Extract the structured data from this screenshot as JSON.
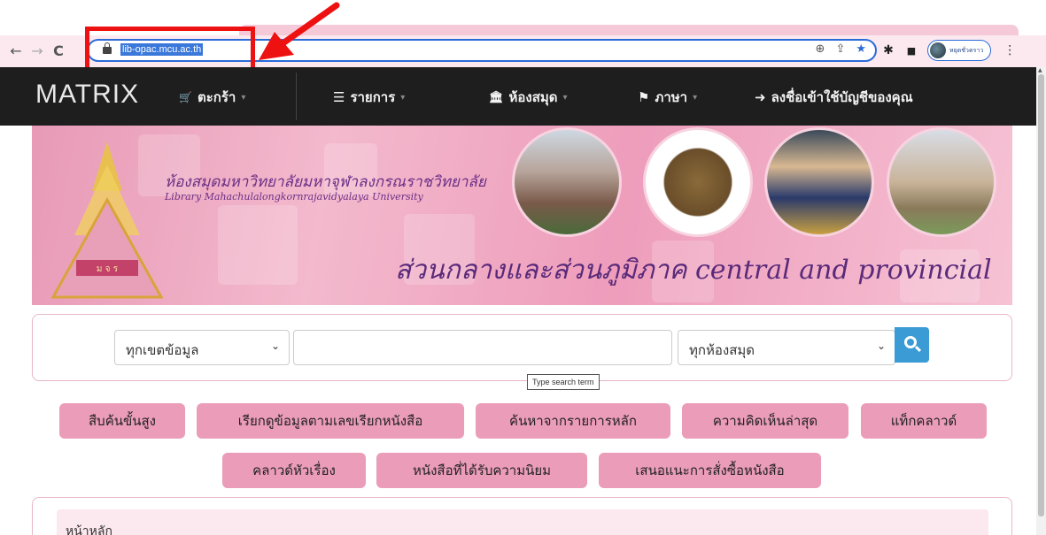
{
  "browser": {
    "url": "lib-opac.mcu.ac.th",
    "profile_name": "หยุดชั่วคราว",
    "nav": {
      "back": "←",
      "forward": "→",
      "reload": "C"
    },
    "omni_icons": {
      "zoom": "⊕",
      "share": "⇪",
      "star": "★"
    },
    "ext_icons": {
      "puzzle": "✱",
      "sidebar": "■",
      "menu": "⋮"
    }
  },
  "site_nav": {
    "brand": "MATRIX",
    "cart": "ตะกร้า",
    "lists": "รายการ",
    "library": "ห้องสมุด",
    "language": "ภาษา",
    "login": "ลงชื่อเข้าใช้บัญชีของคุณ",
    "icons": {
      "cart": "🛒",
      "lists": "☰",
      "library": "🏛",
      "language": "⚑",
      "login": "➜"
    }
  },
  "banner": {
    "title_th": "ห้องสมุดมหาวิทยาลัยมหาจุฬาลงกรณราชวิทยาลัย",
    "title_en": "Library Mahachulalongkornrajavidyalaya University",
    "tagline": "ส่วนกลางและส่วนภูมิภาค central and provincial",
    "emblem_text": "ม จ ร"
  },
  "search": {
    "scope_selected": "ทุกเขตข้อมูล",
    "library_selected": "ทุกห้องสมุด",
    "input_value": "",
    "tooltip": "Type search term"
  },
  "quick_links": {
    "advanced": "สืบค้นขั้นสูง",
    "browse_callnumber": "เรียกดูข้อมูลตามเลขเรียกหนังสือ",
    "authority": "ค้นหาจากรายการหลัก",
    "recent_comments": "ความคิดเห็นล่าสุด",
    "tag_cloud": "แท็กคลาวด์",
    "subject_cloud": "คลาวด์หัวเรื่อง",
    "popular": "หนังสือที่ได้รับความนิยม",
    "suggest_purchase": "เสนอแนะการสั่งซื้อหนังสือ"
  },
  "breadcrumb": {
    "home": "หน้าหลัก"
  },
  "colors": {
    "accent_pink": "#eb9cb8",
    "nav_bg": "#1e1e1e",
    "search_blue": "#3a9bd5",
    "annotation_red": "#ee1111"
  }
}
